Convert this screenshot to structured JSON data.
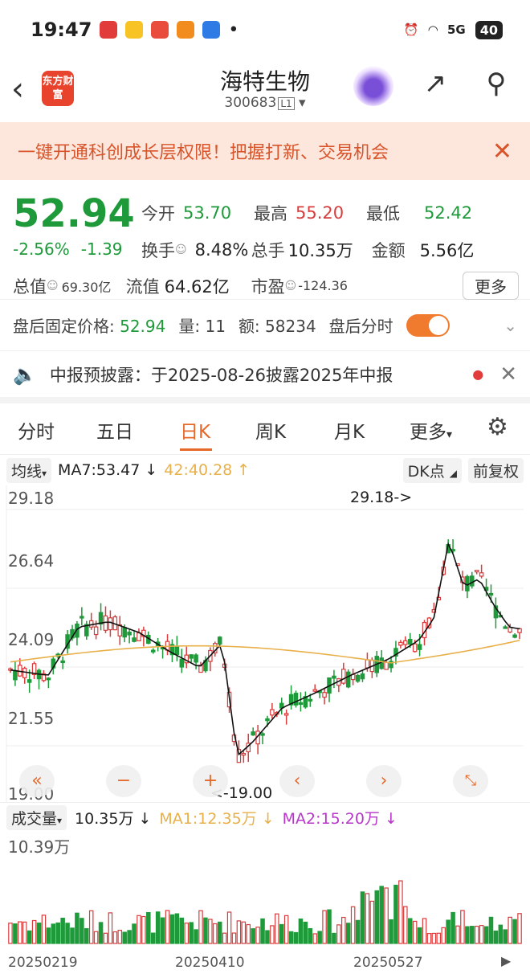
{
  "status": {
    "time": "19:47",
    "battery": "40",
    "signal": "5G"
  },
  "header": {
    "title": "海特生物",
    "code": "300683",
    "level": "L1",
    "logo": "东方财富"
  },
  "banner": {
    "text": "一键开通科创成长层权限！把握打新、交易机会"
  },
  "quote": {
    "price": "52.94",
    "pct": "-2.56%",
    "chg": "-1.39",
    "open_l": "今开",
    "open": "53.70",
    "high_l": "最高",
    "high": "55.20",
    "low_l": "最低",
    "low": "52.42",
    "turn_l": "换手",
    "turn": "8.48%",
    "vol_l": "总手",
    "vol": "10.35万",
    "amt_l": "金额",
    "amt": "5.56亿",
    "mcap_l": "总值",
    "mcap": "69.30亿",
    "flt_l": "流值",
    "flt": "64.62亿",
    "pe_l": "市盈",
    "pe": "-124.36",
    "more": "更多"
  },
  "after": {
    "fixed_l": "盘后固定价格:",
    "fixed": "52.94",
    "qty_l": "量:",
    "qty": "11",
    "amt_l": "额:",
    "amt": "58234",
    "timeshare": "盘后分时"
  },
  "notice": {
    "text": "中报预披露：于2025-08-26披露2025年中报"
  },
  "tabs": [
    "分时",
    "五日",
    "日K",
    "周K",
    "月K",
    "更多"
  ],
  "indicator": {
    "sel": "均线",
    "ma7": "MA7:53.47 ↓",
    "ma": "42:40.28 ↑",
    "dk": "DK点",
    "fq": "前复权"
  },
  "kline": {
    "ymax": "29.18",
    "y2": "26.64",
    "y3": "24.09",
    "y4": "21.55",
    "ymin": "19.00",
    "hi_label": "29.18->",
    "lo_label": "<-19.00"
  },
  "volume": {
    "sel": "成交量",
    "v": "10.35万 ↓",
    "ma1": "MA1:12.35万 ↓",
    "ma2": "MA2:15.20万 ↓",
    "max": "10.39万"
  },
  "dates": [
    "20250219",
    "20250410",
    "20250527"
  ],
  "colors": {
    "up": "#d83c3c",
    "down": "#1e9a3a",
    "ma_short": "#111111",
    "ma_long": "#e8b04a",
    "ma2": "#b637c8"
  }
}
